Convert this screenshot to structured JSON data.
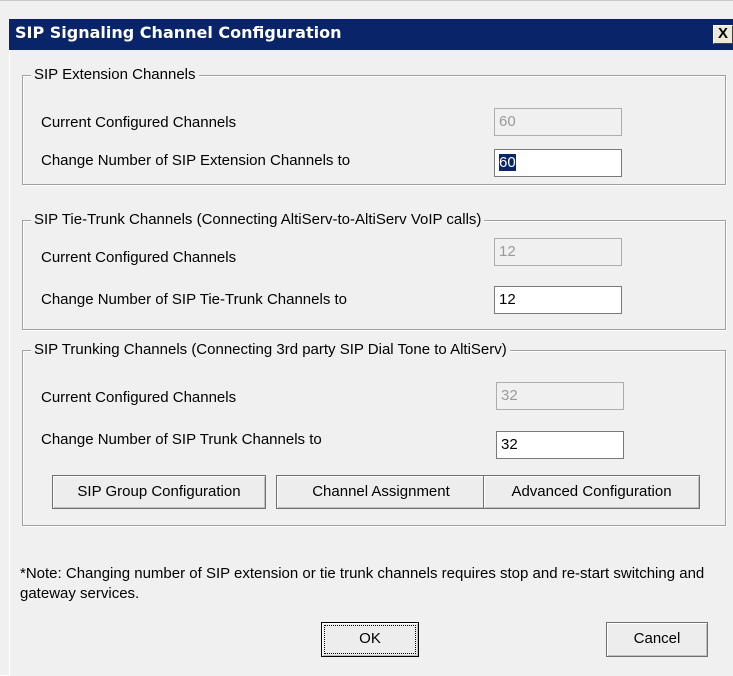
{
  "window": {
    "title": "SIP Signaling Channel Configuration",
    "close_glyph": "X"
  },
  "extension": {
    "legend": "SIP Extension Channels",
    "current_label": "Current Configured Channels",
    "current_value": "60",
    "change_label": "Change Number of SIP Extension Channels to",
    "change_value": "60"
  },
  "tie_trunk": {
    "legend": "SIP Tie-Trunk Channels (Connecting AltiServ-to-AltiServ VoIP calls)",
    "current_label": "Current Configured Channels",
    "current_value": "12",
    "change_label": "Change Number of SIP Tie-Trunk Channels to",
    "change_value": "12"
  },
  "trunking": {
    "legend": "SIP Trunking Channels (Connecting 3rd party SIP Dial Tone to AltiServ)",
    "current_label": "Current Configured Channels",
    "current_value": "32",
    "change_label": "Change Number of SIP Trunk Channels to",
    "change_value": "32",
    "buttons": {
      "group_config": "SIP Group Configuration",
      "channel_assignment": "Channel Assignment",
      "advanced_config": "Advanced Configuration"
    }
  },
  "note": "*Note: Changing number of SIP extension or tie trunk channels requires stop and re-start switching and gateway services.",
  "footer": {
    "ok": "OK",
    "cancel": "Cancel"
  }
}
